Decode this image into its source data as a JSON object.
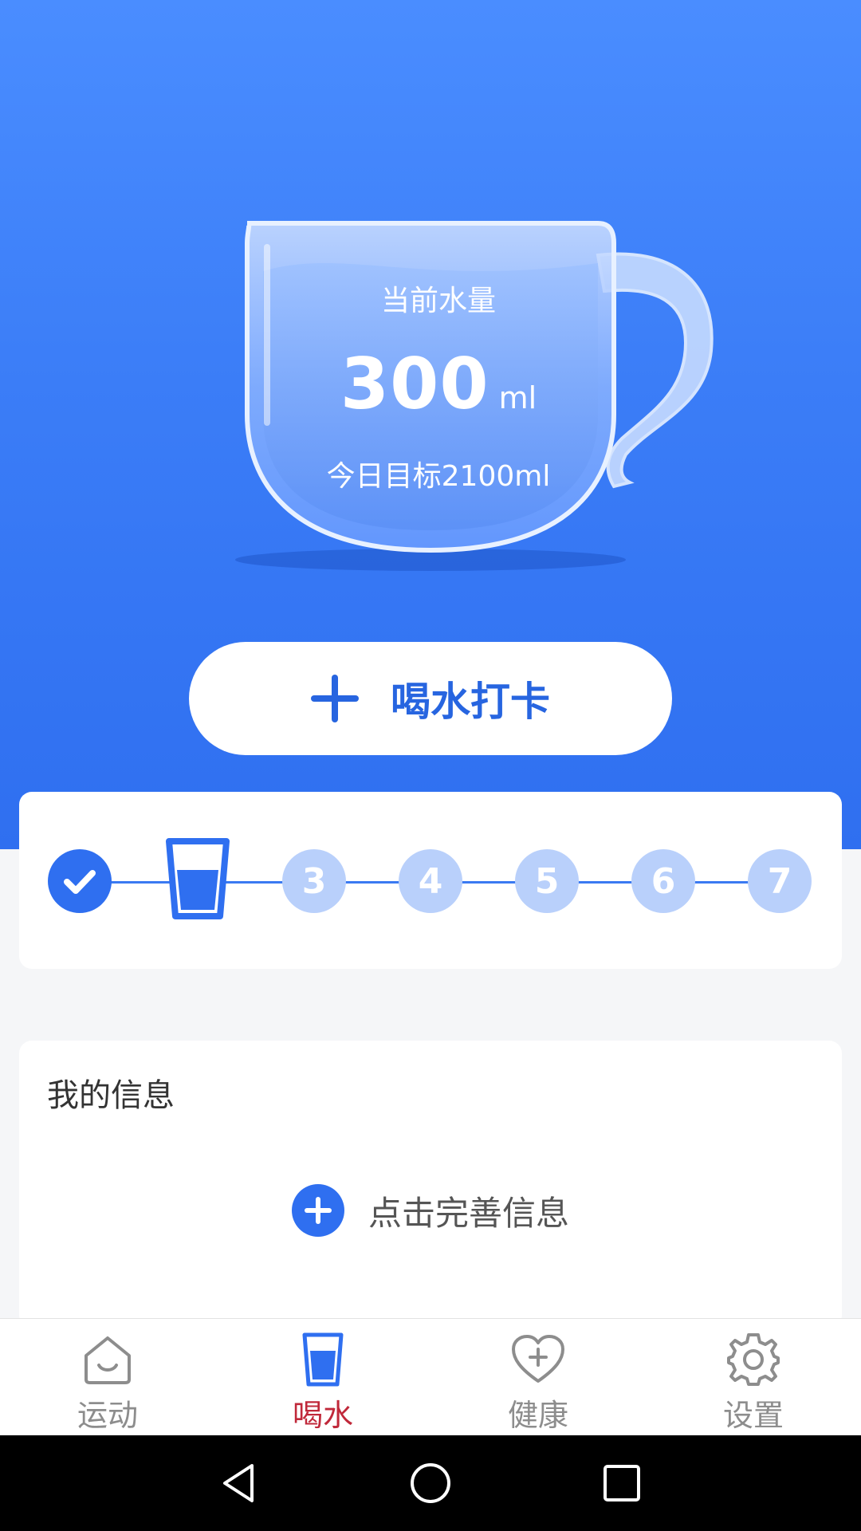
{
  "water": {
    "current_label": "当前水量",
    "current_value": "300",
    "current_unit": "ml",
    "goal_text": "今日目标2100ml"
  },
  "checkin": {
    "label": "喝水打卡",
    "icon": "plus-icon"
  },
  "progress": {
    "steps": [
      {
        "number": "1",
        "state": "done",
        "icon": "check-icon"
      },
      {
        "number": "2",
        "state": "current",
        "icon": "water-glass-icon"
      },
      {
        "number": "3",
        "state": "pending"
      },
      {
        "number": "4",
        "state": "pending"
      },
      {
        "number": "5",
        "state": "pending"
      },
      {
        "number": "6",
        "state": "pending"
      },
      {
        "number": "7",
        "state": "pending"
      }
    ]
  },
  "info": {
    "title": "我的信息",
    "complete_label": "点击完善信息",
    "complete_icon": "plus-circle-icon"
  },
  "nav": {
    "items": [
      {
        "label": "运动",
        "icon": "home-smile-icon",
        "active": false
      },
      {
        "label": "喝水",
        "icon": "water-glass-icon",
        "active": true
      },
      {
        "label": "健康",
        "icon": "heart-plus-icon",
        "active": false
      },
      {
        "label": "设置",
        "icon": "gear-icon",
        "active": false
      }
    ]
  },
  "colors": {
    "primary": "#2f6ff0",
    "hero_top": "#4a8dff",
    "active_nav": "#c0283a",
    "inactive_nav": "#8d8d8d",
    "step_pending": "#b9d0fb"
  }
}
